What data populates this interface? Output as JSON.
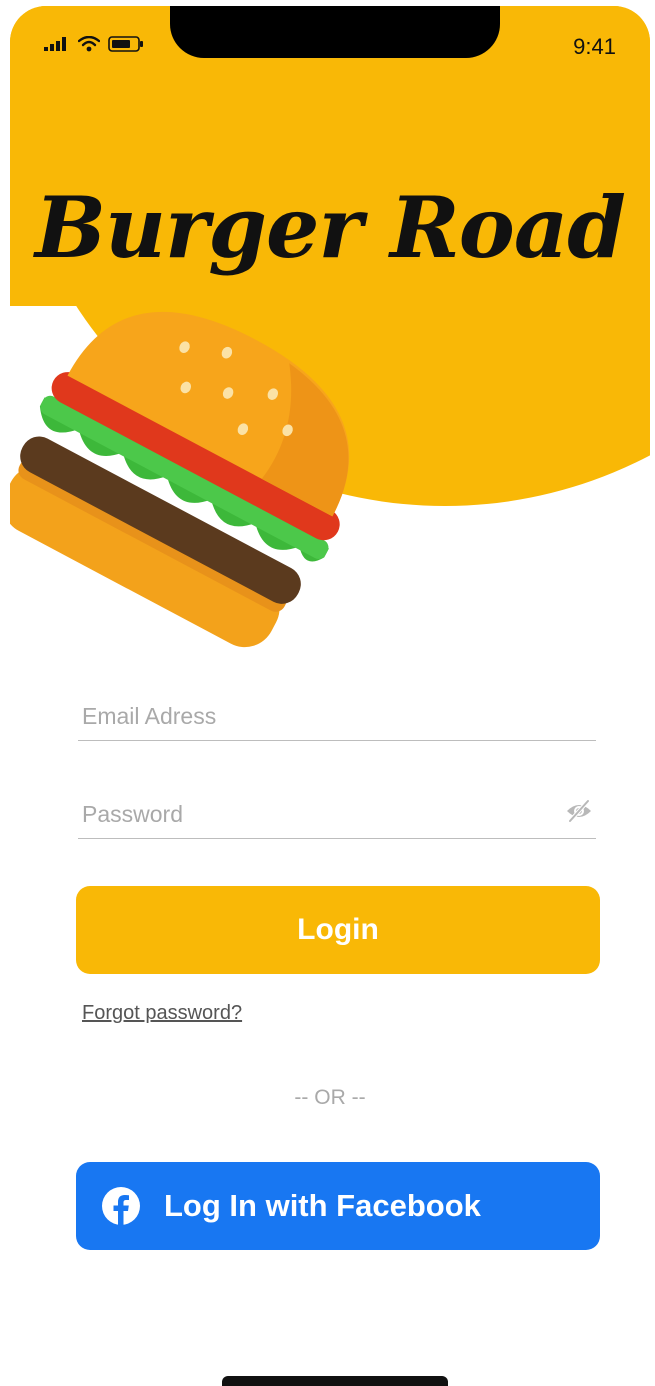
{
  "colors": {
    "brand_yellow": "#F9B806",
    "facebook_blue": "#1877F2",
    "title_black": "#111111"
  },
  "status_bar": {
    "time": "9:41",
    "icons": [
      "cellular-signal-icon",
      "wifi-icon",
      "battery-icon"
    ]
  },
  "brand": {
    "title": "Burger Road",
    "illustration": "burger-illustration"
  },
  "form": {
    "email_placeholder": "Email Adress",
    "email_value": "",
    "password_placeholder": "Password",
    "password_value": "",
    "password_toggle_icon": "eye-slash-icon"
  },
  "actions": {
    "login_label": "Login",
    "forgot_label": "Forgot password?",
    "separator": "-- OR --",
    "facebook_label": "Log In with Facebook",
    "facebook_icon": "facebook-icon"
  }
}
